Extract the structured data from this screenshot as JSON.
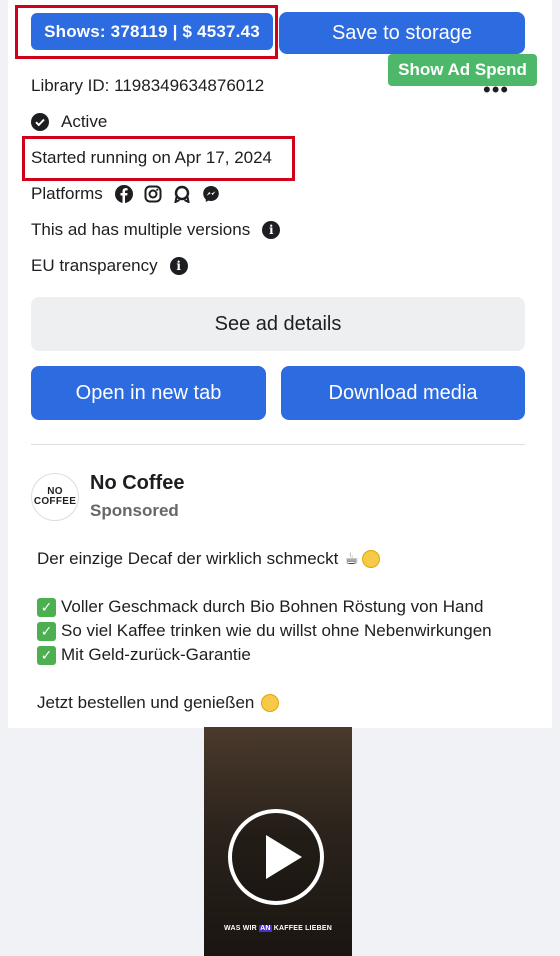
{
  "top": {
    "shows_label": "Shows: 378119 | $ 4537.43",
    "save_label": "Save to storage",
    "ad_spend_label": "Show Ad Spend",
    "more_label": "•••"
  },
  "details": {
    "library_id": "Library ID: 1198349634876012",
    "status": "Active",
    "started": "Started running on Apr 17, 2024",
    "platforms_label": "Platforms",
    "platform_icons": [
      "facebook-icon",
      "instagram-icon",
      "audience-network-icon",
      "messenger-icon"
    ],
    "versions_label": "This ad has multiple versions",
    "eu_label": "EU transparency"
  },
  "actions": {
    "see_details": "See ad details",
    "open_new_tab": "Open in new tab",
    "download_media": "Download media"
  },
  "ad": {
    "avatar_line1": "NO",
    "avatar_line2": "COFFEE",
    "brand_name": "No Coffee",
    "sponsored": "Sponsored",
    "line1": "Der einzige Decaf der wirklich schmeckt",
    "bullet1": "Voller Geschmack durch Bio Bohnen Röstung von Hand",
    "bullet2": "So viel Kaffee trinken wie du willst ohne Nebenwirkungen",
    "bullet3": "Mit Geld-zurück-Garantie",
    "closing": "Jetzt bestellen und genießen",
    "caption_a": "WAS WIR ",
    "caption_b": "AN",
    "caption_c": " KAFFEE LIEBEN"
  },
  "colors": {
    "primary_blue": "#2d6be0",
    "ad_spend_green": "#4db86a",
    "highlight_red": "#d0021b"
  }
}
